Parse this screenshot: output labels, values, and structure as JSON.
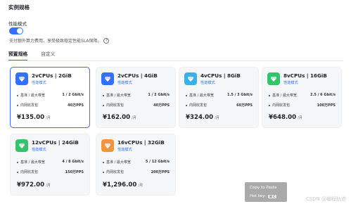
{
  "section_title": "实例规格",
  "performance": {
    "label": "性能模式",
    "enabled": true,
    "description": "支付额外算力费用，享受极致稳定性能SLA保障。",
    "help_icon": "?"
  },
  "tabs": [
    {
      "label": "预置规格",
      "active": true
    },
    {
      "label": "自定义",
      "active": false
    }
  ],
  "cards": [
    {
      "title": "2vCPUs | 2GiB",
      "badge": "性能模式",
      "bandwidth_label": "基准 / 最大带宽",
      "bandwidth": "1 / 2 Gbit/s",
      "pps_label": "内网收发包",
      "pps": "40万PPS",
      "price": "¥135.00",
      "unit": "/月",
      "icon_color": "#3370ff",
      "icon": "diamond-icon",
      "selected": true
    },
    {
      "title": "2vCPUs | 4GiB",
      "badge": "性能模式",
      "bandwidth_label": "基准 / 最大带宽",
      "bandwidth": "1 / 2 Gbit/s",
      "pps_label": "内网收发包",
      "pps": "40万PPS",
      "price": "¥162.00",
      "unit": "/月",
      "icon_color": "#3370ff",
      "icon": "diamond-icon",
      "selected": false
    },
    {
      "title": "4vCPUs | 8GiB",
      "badge": "性能模式",
      "bandwidth_label": "基准 / 最大带宽",
      "bandwidth": "1.5 / 3 Gbit/s",
      "pps_label": "内网收发包",
      "pps": "60万PPS",
      "price": "¥324.00",
      "unit": "/月",
      "icon_color": "#3ab0e8",
      "icon": "diamond-icon",
      "selected": false
    },
    {
      "title": "8vCPUs | 16GiB",
      "badge": "性能模式",
      "bandwidth_label": "基准 / 最大带宽",
      "bandwidth": "2.5 / 6 Gbit/s",
      "pps_label": "内网收发包",
      "pps": "100万PPS",
      "price": "¥648.00",
      "unit": "/月",
      "icon_color": "#34c56b",
      "icon": "diamond-icon",
      "selected": false
    },
    {
      "title": "12vCPUs | 24GiB",
      "badge": "性能模式",
      "bandwidth_label": "基准 / 最大带宽",
      "bandwidth": "4 / 8 Gbit/s",
      "pps_label": "内网收发包",
      "pps": "150万PPS",
      "price": "¥972.00",
      "unit": "/月",
      "icon_color": "#34c56b",
      "icon": "diamond-icon",
      "selected": false
    },
    {
      "title": "16vCPUs | 32GiB",
      "badge": "性能模式",
      "bandwidth_label": "基准 / 最大带宽",
      "bandwidth": "5 / 12 Gbit/s",
      "pps_label": "内网收发包",
      "pps": "200万PPS",
      "price": "¥1,296.00",
      "unit": "/月",
      "icon_color": "#f0953a",
      "icon": "diamond-icon",
      "selected": false
    }
  ],
  "tooltip": {
    "title": "Copy to Paste",
    "hotkey_label": "Hot key:",
    "hotkey": "⌘ C"
  },
  "watermark": "CSDN @编程轨迹"
}
